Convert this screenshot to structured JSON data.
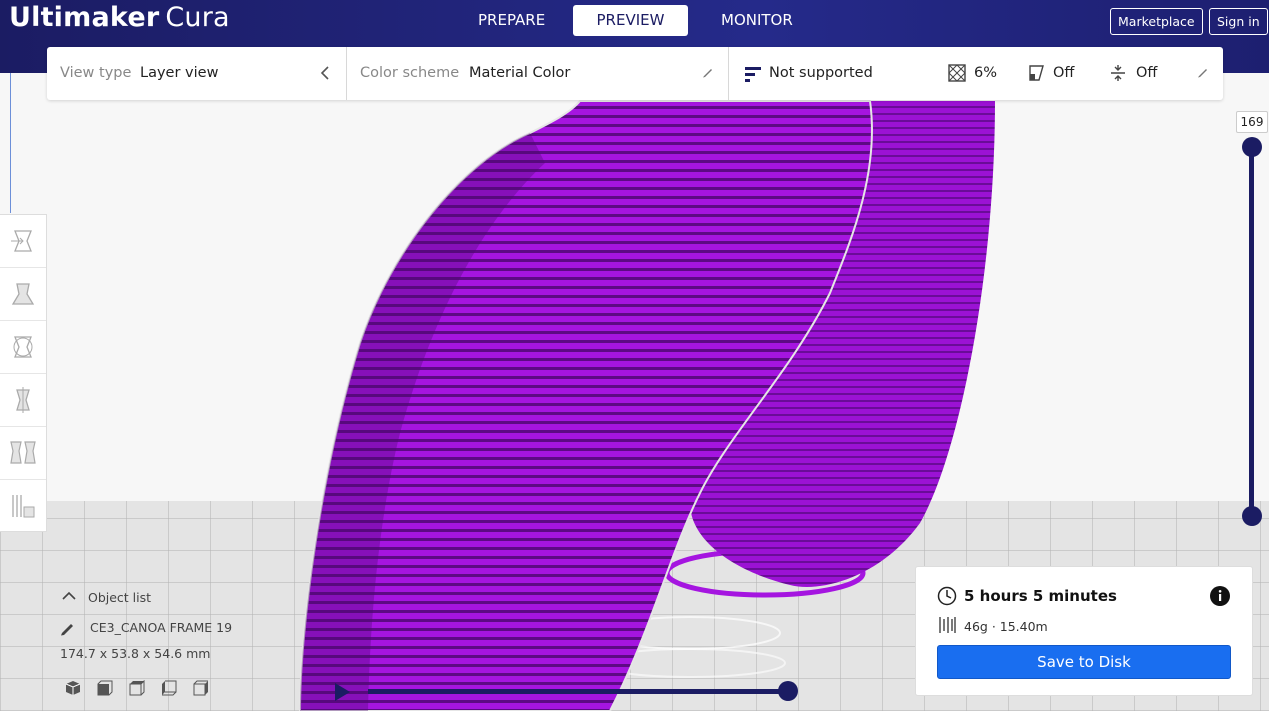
{
  "app": {
    "title_bold": "Ultimaker",
    "title_light": "Cura"
  },
  "stages": [
    {
      "label": "PREPARE",
      "active": false
    },
    {
      "label": "PREVIEW",
      "active": true
    },
    {
      "label": "MONITOR",
      "active": false
    }
  ],
  "header_buttons": {
    "marketplace": "Marketplace",
    "sign_in": "Sign in"
  },
  "view_bar": {
    "view_type_label": "View type",
    "view_type_value": "Layer view",
    "color_scheme_label": "Color scheme",
    "color_scheme_value": "Material Color",
    "support_status": "Not supported",
    "infill": "6%",
    "support": "Off",
    "adhesion": "Off"
  },
  "tools": [
    "move-tool",
    "scale-tool",
    "rotate-tool",
    "mirror-tool",
    "per-model-settings-tool",
    "support-blocker-tool"
  ],
  "layer_slider": {
    "current_layer": "169",
    "fraction": 1.0
  },
  "object_list": {
    "title": "Object list",
    "object_name": "CE3_CANOA FRAME 19",
    "dimensions": "174.7 x 53.8 x 54.6 mm"
  },
  "camera_views": [
    "3d-view",
    "front-view",
    "top-view",
    "left-view",
    "right-view"
  ],
  "print_info": {
    "time": "5 hours 5 minutes",
    "material": "46g · 15.40m",
    "save_button": "Save to Disk"
  },
  "colors": {
    "header": "#1b1c63",
    "accent": "#196ef0",
    "model_material": "#9d12d6"
  }
}
